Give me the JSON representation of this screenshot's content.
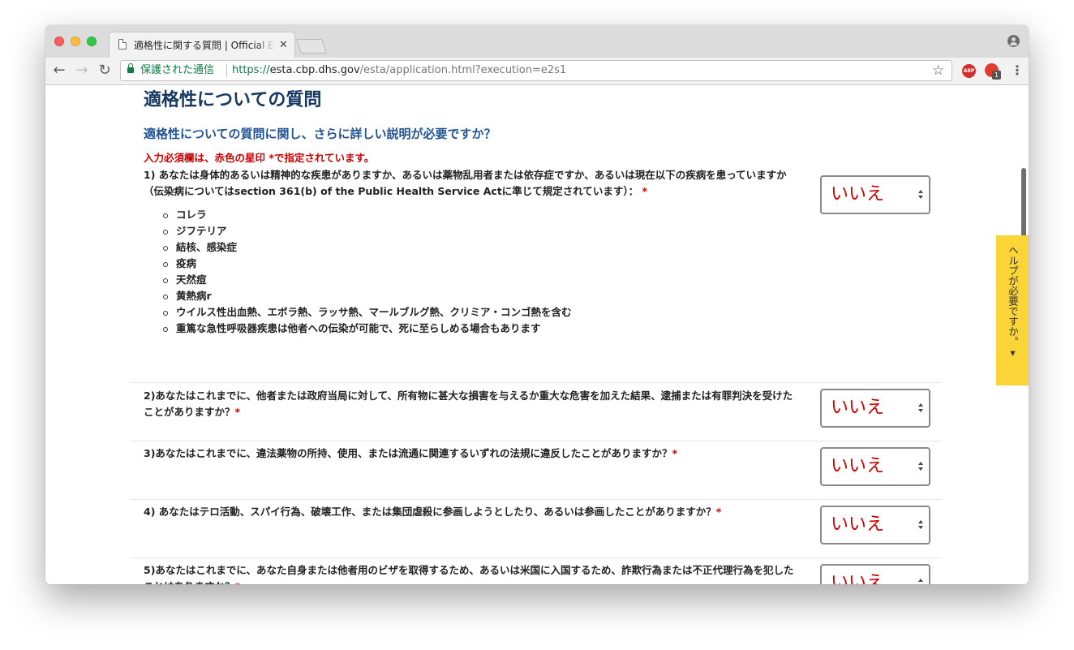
{
  "browser": {
    "tab_title": "適格性に関する質問 | Official ESTA",
    "tab_close": "✕",
    "secure_label": "保護された通信",
    "url_scheme": "https://",
    "url_host": "esta.cbp.dhs.gov",
    "url_path": "/esta/application.html?execution=e2s1",
    "extension_abp_label": "ABP",
    "extension_badge": "1",
    "icons": [
      "back-icon",
      "forward-icon",
      "reload-icon",
      "lock-icon",
      "star-icon",
      "menu-icon",
      "profile-icon"
    ]
  },
  "page": {
    "title": "適格性についての質問",
    "subtitle": "適格性についての質問に関し、さらに詳しい説明が必要ですか？",
    "required_note": "入力必須欄は、赤色の星印 *で指定されています。",
    "required_mark": "*",
    "help_tab": "ヘルプが必要ですか。▾",
    "colors": {
      "title": "#173961",
      "subtitle": "#205493",
      "required": "#cc0000",
      "help_tab": "#fbd537"
    }
  },
  "questions": [
    {
      "text": "1) あなたは身体的あるいは精神的な疾患がありますか、あるいは薬物乱用者または依存症ですか、あるいは現在以下の疾病を患っていますか（伝染病についてはsection 361(b) of the Public Health Service Actに準じて規定されています）：",
      "answer": "いいえ",
      "diseases": [
        "コレラ",
        "ジフテリア",
        "結核、感染症",
        "疫病",
        "天然痘",
        "黄熱病r",
        "ウイルス性出血熱、エボラ熱、ラッサ熱、マールブルグ熱、クリミア・コンゴ熱を含む",
        "重篤な急性呼吸器疾患は他者への伝染が可能で、死に至らしめる場合もあります"
      ]
    },
    {
      "text": "2)あなたはこれまでに、他者または政府当局に対して、所有物に甚大な損害を与えるか重大な危害を加えた結果、逮捕または有罪判決を受けたことがありますか？",
      "answer": "いいえ"
    },
    {
      "text": "3)あなたはこれまでに、違法薬物の所持、使用、または流通に関連するいずれの法規に違反したことがありますか？",
      "answer": "いいえ"
    },
    {
      "text": "4) あなたはテロ活動、スパイ行為、破壊工作、または集団虐殺に参画しようとしたり、あるいは参画したことがありますか？",
      "answer": "いいえ"
    },
    {
      "text": "5)あなたはこれまでに、あなた自身または他者用のビザを取得するため、あるいは米国に入国するため、詐欺行為または不正代理行為を犯したことはありますか？",
      "answer": "いいえ"
    }
  ]
}
